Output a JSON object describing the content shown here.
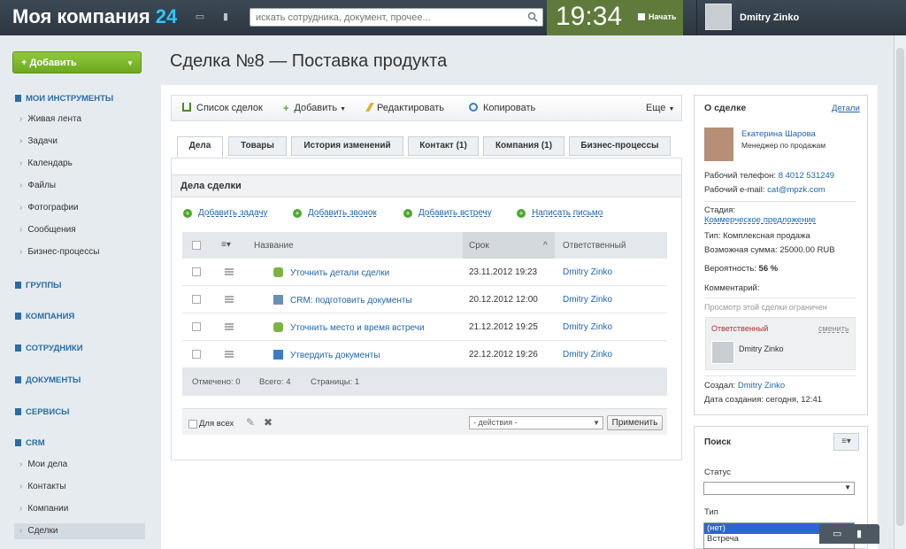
{
  "header": {
    "logo": "Моя компания",
    "logo_num": "24",
    "search_placeholder": "искать сотрудника, документ, прочее...",
    "time": "19:34",
    "start": "Начать",
    "user": "Dmitry Zinko"
  },
  "sidebar": {
    "add": "Добавить",
    "my_tools": "МОИ ИНСТРУМЕНТЫ",
    "tools": [
      "Живая лента",
      "Задачи",
      "Календарь",
      "Файлы",
      "Фотографии",
      "Сообщения",
      "Бизнес-процессы"
    ],
    "groups": "ГРУППЫ",
    "company": "КОМПАНИЯ",
    "employees": "СОТРУДНИКИ",
    "documents": "ДОКУМЕНТЫ",
    "services": "СЕРВИСЫ",
    "crm": "CRM",
    "crm_items": [
      "Мои дела",
      "Контакты",
      "Компании",
      "Сделки"
    ]
  },
  "page": {
    "title": "Сделка №8 — Поставка продукта",
    "toolbar": {
      "list": "Список сделок",
      "add": "Добавить",
      "edit": "Редактировать",
      "copy": "Копировать",
      "more": "Еще"
    },
    "tabs": [
      "Дела",
      "Товары",
      "История изменений",
      "Контакт (1)",
      "Компания (1)",
      "Бизнес-процессы"
    ],
    "panel_title": "Дела сделки",
    "actions": [
      "Добавить задачу",
      "Добавить звонок",
      "Добавить встречу",
      "Написать письмо"
    ],
    "columns": {
      "name": "Название",
      "date": "Срок",
      "owner": "Ответственный"
    },
    "rows": [
      {
        "title": "Уточнить детали сделки",
        "date": "23.11.2012 19:23",
        "owner": "Dmitry Zinko"
      },
      {
        "title": "CRM: подготовить документы",
        "date": "20.12.2012 12:00",
        "owner": "Dmitry Zinko"
      },
      {
        "title": "Уточнить место и время встречи",
        "date": "21.12.2012 19:25",
        "owner": "Dmitry Zinko"
      },
      {
        "title": "Утвердить документы",
        "date": "22.12.2012 19:26",
        "owner": "Dmitry Zinko"
      }
    ],
    "footer": {
      "marked": "Отмечено: 0",
      "total": "Всего: 4",
      "pages": "Страницы:  1"
    },
    "forall": "Для всех",
    "actions_select": "- действия -",
    "apply": "Применить"
  },
  "about": {
    "title": "О сделке",
    "details": "Детали",
    "person": "Екатерина Шарова",
    "position": "Менеджер по продажам",
    "phone_label": "Рабочий телефон:",
    "phone": "8 4012 531249",
    "email_label": "Рабочий e-mail:",
    "email": "cat@mpzk.com",
    "stage_label": "Стадия:",
    "stage": "Коммерческое предложение",
    "type": "Тип: Комплексная продажа",
    "sum_label": "Возможная сумма:",
    "sum": "25000.00 RUB",
    "prob_label": "Вероятность:",
    "prob": "56 %",
    "comment": "Комментарий:",
    "restricted": "Просмотр этой сделки ограничен",
    "responsible": "Ответственный",
    "change": "сменить",
    "resp_name": "Dmitry Zinko",
    "created_label": "Создал:",
    "created_by": "Dmitry Zinko",
    "created_date": "Дата создания: сегодня, 12:41"
  },
  "search": {
    "title": "Поиск",
    "status": "Статус",
    "type": "Тип",
    "options": [
      "(нет)",
      "Встреча"
    ]
  }
}
